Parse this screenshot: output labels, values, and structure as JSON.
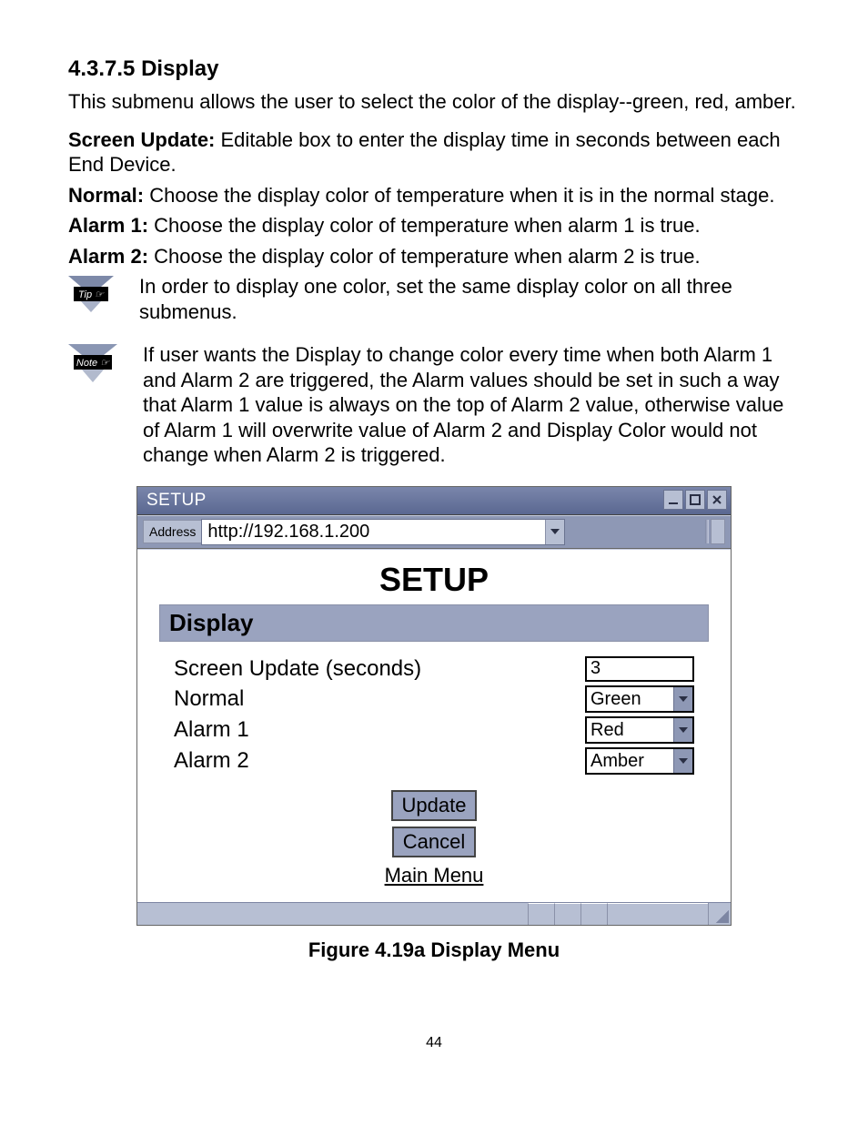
{
  "section": {
    "heading": "4.3.7.5 Display",
    "intro": "This submenu allows the user to select the color of the display--green, red, amber.",
    "defs": [
      {
        "label": "Screen Update:",
        "text": " Editable box to enter the display time in seconds between each End Device."
      },
      {
        "label": "Normal:",
        "text": "  Choose the display color of temperature when it is in the normal stage."
      },
      {
        "label": "Alarm 1:",
        "text": "  Choose the display color of temperature when alarm 1 is true."
      },
      {
        "label": "Alarm 2:",
        "text": "  Choose the display color of temperature when alarm 2 is true."
      }
    ],
    "tip": "In order to display one color, set the same display color on all three submenus.",
    "note": "If user wants the Display to change color every time when both Alarm 1 and Alarm 2 are triggered, the Alarm values should be set in such a way that Alarm 1 value is always on the top of Alarm 2 value, otherwise value of Alarm 1 will overwrite value of Alarm 2 and Display Color would not change when Alarm 2 is triggered.",
    "tip_badge_label": "Tip ☞",
    "note_badge_label": "Note ☞"
  },
  "window": {
    "title": "SETUP",
    "address_label": "Address",
    "address_value": "http://192.168.1.200",
    "page_title": "SETUP",
    "panel_title": "Display",
    "rows": {
      "screen_update_label": "Screen Update (seconds)",
      "screen_update_value": "3",
      "normal_label": "Normal",
      "normal_value": "Green",
      "alarm1_label": "Alarm 1",
      "alarm1_value": "Red",
      "alarm2_label": "Alarm 2",
      "alarm2_value": "Amber"
    },
    "buttons": {
      "update": "Update",
      "cancel": "Cancel",
      "main_menu": "Main Menu"
    }
  },
  "figure_caption": "Figure 4.19a  Display Menu",
  "page_number": "44"
}
